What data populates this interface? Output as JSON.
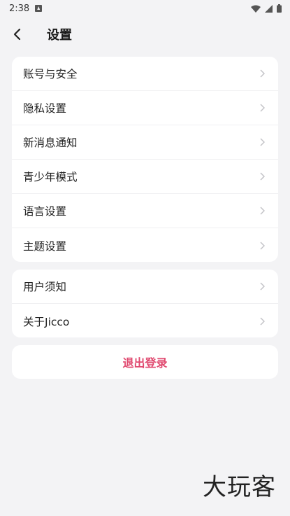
{
  "status": {
    "time": "2:38"
  },
  "header": {
    "title": "设置"
  },
  "group1": [
    {
      "label": "账号与安全"
    },
    {
      "label": "隐私设置"
    },
    {
      "label": "新消息通知"
    },
    {
      "label": "青少年模式"
    },
    {
      "label": "语言设置"
    },
    {
      "label": "主题设置"
    }
  ],
  "group2": [
    {
      "label": "用户须知"
    },
    {
      "label": "关于Jicco"
    }
  ],
  "logout": {
    "label": "退出登录",
    "color": "#e04a70"
  },
  "watermark": {
    "text": "大玩客"
  }
}
